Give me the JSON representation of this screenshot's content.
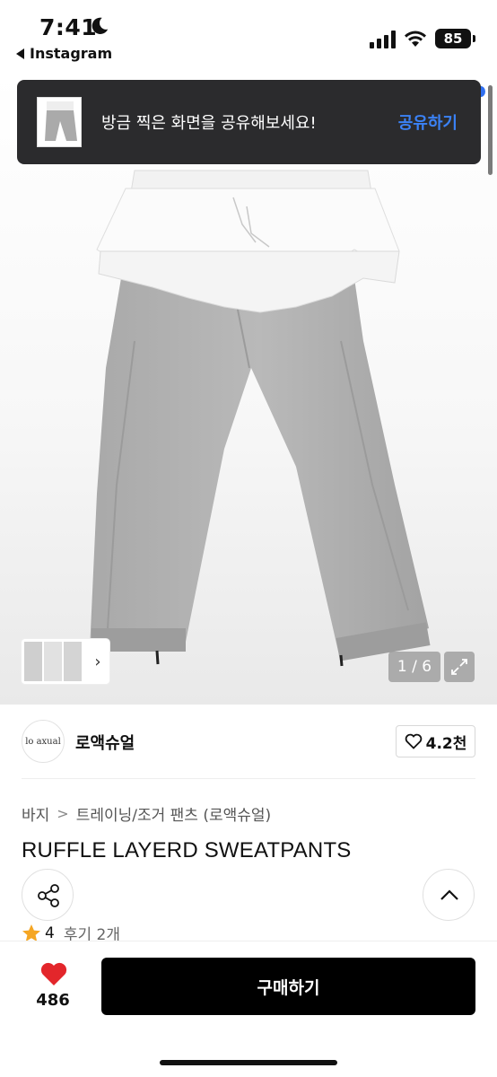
{
  "status_bar": {
    "time": "7:41",
    "back_app": "Instagram",
    "battery": "85"
  },
  "toast": {
    "message": "방금 찍은 화면을 공유해보세요!",
    "action": "공유하기"
  },
  "gallery": {
    "counter": "1 / 6",
    "thumb_chevron": "›"
  },
  "shop": {
    "logo_text": "lo axual",
    "name": "로액슈얼",
    "likes": "4.2천"
  },
  "breadcrumb": [
    "바지",
    "트레이닝/조거 팬츠 (로액슈얼)"
  ],
  "breadcrumb_separator": ">",
  "product": {
    "title": "RUFFLE LAYERD SWEATPANTS",
    "rating": "4",
    "review_label": "후기 2개"
  },
  "bottom": {
    "like_count": "486",
    "buy_label": "구매하기"
  },
  "colors": {
    "accent_blue": "#3b82f6",
    "heart_red": "#e3262b",
    "star_orange": "#f5a623",
    "buy_bg": "#000000"
  },
  "icons": [
    "moon-icon",
    "signal-icon",
    "wifi-icon",
    "heart-outline-icon",
    "share-icon",
    "chevron-up-icon",
    "star-icon",
    "heart-filled-icon",
    "expand-icon"
  ]
}
